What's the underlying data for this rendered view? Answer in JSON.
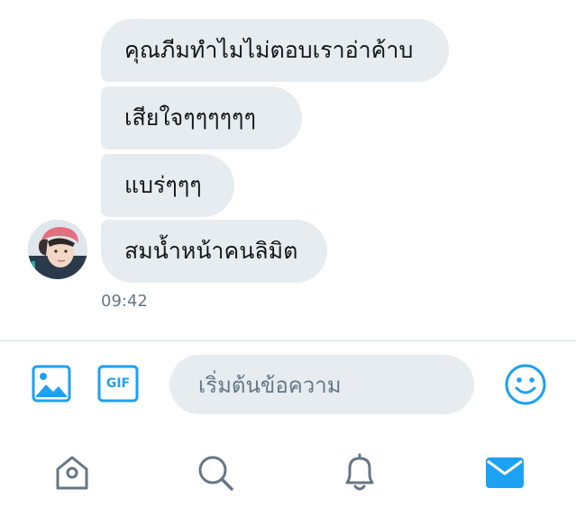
{
  "conversation": {
    "messages": [
      {
        "text": "คุณภีมทำไมไม่ตอบเราอ่าค้าบ"
      },
      {
        "text": "เสียใจๆๆๆๆๆๆ"
      },
      {
        "text": "แบร่ๆๆๆ"
      },
      {
        "text": "สมน้ำหน้าคนลิมิต"
      }
    ],
    "timestamp": "09:42"
  },
  "composer": {
    "placeholder": "เริ่มต้นข้อความ",
    "gif_label": "GIF"
  },
  "colors": {
    "accent": "#1da1f2",
    "bubble_bg": "#e6ecf0",
    "text_primary": "#14171a",
    "text_secondary": "#657786",
    "nav_icon": "#657786"
  },
  "icons": {
    "image": "image-icon",
    "gif": "gif-icon",
    "emoji": "emoji-icon",
    "home": "home-icon",
    "search": "search-icon",
    "notifications": "bell-icon",
    "messages": "mail-icon"
  }
}
